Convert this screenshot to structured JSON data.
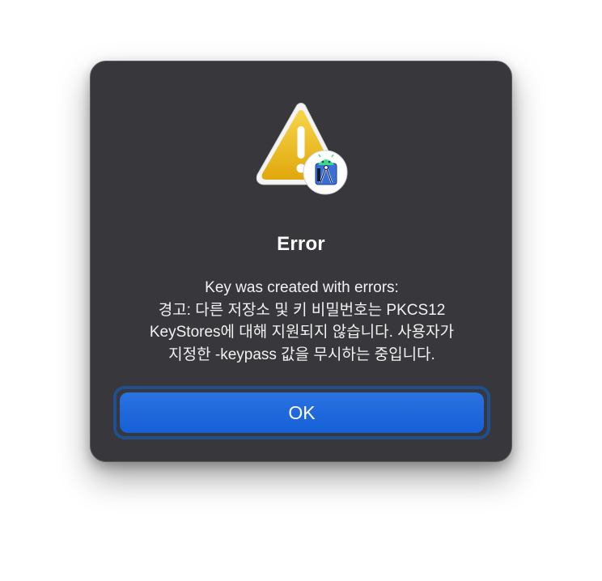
{
  "dialog": {
    "title": "Error",
    "message_lines": [
      "Key was created with errors:",
      "경고: 다른 저장소 및 키 비밀번호는 PKCS12",
      "KeyStores에 대해 지원되지 않습니다. 사용자가",
      "지정한 -keypass 값을 무시하는 중입니다."
    ],
    "ok_label": "OK",
    "icon": "warning-icon",
    "badge_icon": "android-studio-icon"
  },
  "colors": {
    "dialog_background": "#38373c",
    "button_blue": "#1a64dc",
    "warning_yellow": "#f1c21a"
  }
}
